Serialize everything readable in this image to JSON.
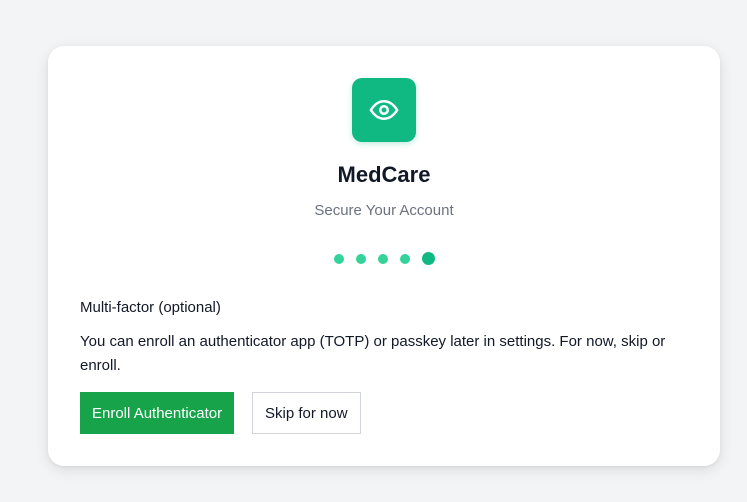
{
  "brand": {
    "app_name": "MedCare",
    "subtitle": "Secure Your Account",
    "icon": "eye-icon",
    "accent_color": "#10b981"
  },
  "stepper": {
    "total_steps": 5,
    "current_step": 5
  },
  "mfa": {
    "title": "Multi-factor (optional)",
    "description": "You can enroll an authenticator app (TOTP) or passkey later in settings. For now, skip or enroll."
  },
  "actions": {
    "enroll_label": "Enroll Authenticator",
    "skip_label": "Skip for now",
    "enroll_color": "#16a34a"
  }
}
